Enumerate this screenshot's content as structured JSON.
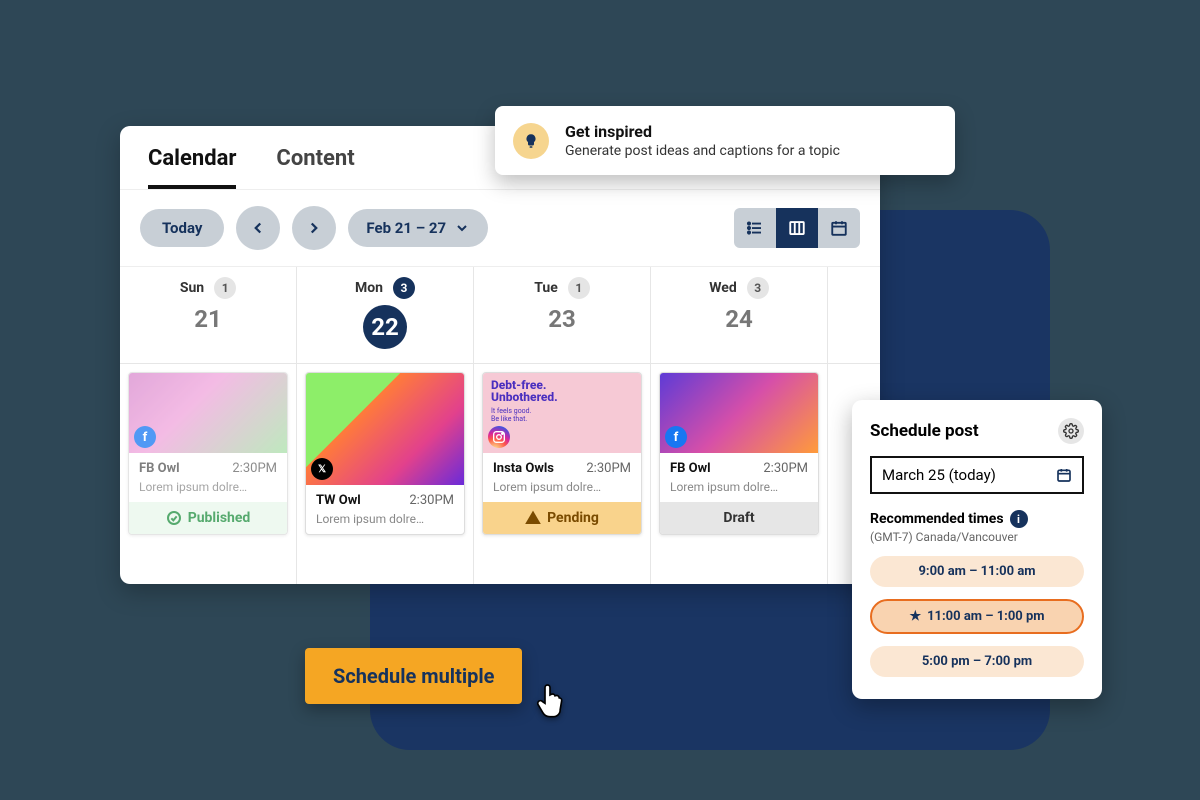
{
  "tabs": {
    "calendar": "Calendar",
    "content": "Content"
  },
  "toolbar": {
    "today": "Today",
    "range": "Feb 21 – 27"
  },
  "inspire": {
    "title": "Get inspired",
    "subtitle": "Generate post ideas and captions for a topic"
  },
  "days": [
    {
      "name": "Sun",
      "num": "21",
      "count": "1"
    },
    {
      "name": "Mon",
      "num": "22",
      "count": "3"
    },
    {
      "name": "Tue",
      "num": "23",
      "count": "1"
    },
    {
      "name": "Wed",
      "num": "24",
      "count": "3"
    }
  ],
  "posts": [
    {
      "network": "fb",
      "title": "FB Owl",
      "time": "2:30PM",
      "text": "Lorem ipsum dolre…",
      "status": "Published"
    },
    {
      "network": "x",
      "title": "TW Owl",
      "time": "2:30PM",
      "text": "Lorem ipsum dolre…",
      "status": ""
    },
    {
      "network": "ig",
      "title": "Insta Owls",
      "time": "2:30PM",
      "text": "Lorem ipsum dolre…",
      "status": "Pending",
      "img_title": "Debt-free.",
      "img_sub": "Unbothered.",
      "img_tag1": "It feels good.",
      "img_tag2": "Be like that."
    },
    {
      "network": "fb",
      "title": "FB Owl",
      "time": "2:30PM",
      "text": "Lorem ipsum dolre…",
      "status": "Draft"
    }
  ],
  "schedule_multiple": "Schedule multiple",
  "schedule_panel": {
    "title": "Schedule post",
    "date": "March 25 (today)",
    "rec_label": "Recommended times",
    "tz": "(GMT-7) Canada/Vancouver",
    "times": [
      "9:00 am – 11:00 am",
      "11:00 am – 1:00 pm",
      "5:00 pm – 7:00 pm"
    ]
  }
}
